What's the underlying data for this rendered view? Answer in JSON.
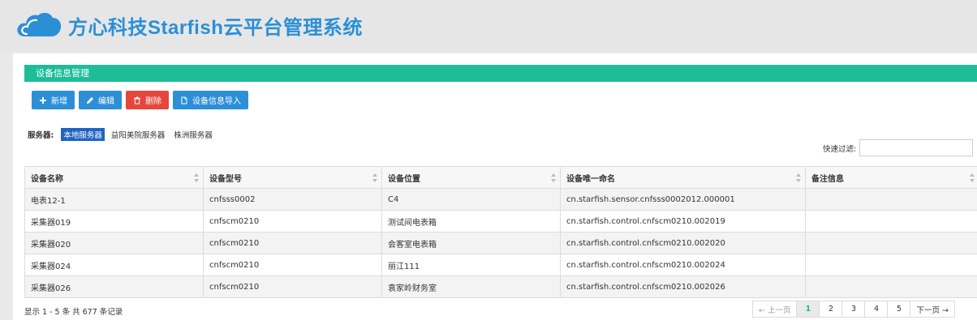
{
  "header": {
    "logo_text": "方心科技Starfish云平台管理系统",
    "logo_icon": "cloud-icon",
    "brand_color": "#2b8fd6"
  },
  "panel": {
    "title": "设备信息管理",
    "title_color": "#1ebd9a"
  },
  "toolbar": {
    "add_label": "新增",
    "edit_label": "编辑",
    "delete_label": "删除",
    "import_label": "设备信息导入"
  },
  "servers": {
    "label": "服务器:",
    "items": [
      "本地服务器",
      "益阳美院服务器",
      "株洲服务器"
    ],
    "selected": "本地服务器"
  },
  "filter": {
    "label": "快速过滤:",
    "value": ""
  },
  "table": {
    "columns": [
      "设备名称",
      "设备型号",
      "设备位置",
      "设备唯一命名",
      "备注信息"
    ],
    "rows": [
      [
        "电表12-1",
        "cnfsss0002",
        "C4",
        "cn.starfish.sensor.cnfsss0002012.000001",
        ""
      ],
      [
        "采集器019",
        "cnfscm0210",
        "测试间电表箱",
        "cn.starfish.control.cnfscm0210.002019",
        ""
      ],
      [
        "采集器020",
        "cnfscm0210",
        "会客室电表箱",
        "cn.starfish.control.cnfscm0210.002020",
        ""
      ],
      [
        "采集器024",
        "cnfscm0210",
        "丽江111",
        "cn.starfish.control.cnfscm0210.002024",
        ""
      ],
      [
        "采集器026",
        "cnfscm0210",
        "袁家岭财务室",
        "cn.starfish.control.cnfscm0210.002026",
        ""
      ]
    ]
  },
  "footer": {
    "info": "显示 1 - 5 条 共 677 条记录"
  },
  "pagination": {
    "prev": "← 上一页",
    "pages": [
      "1",
      "2",
      "3",
      "4",
      "5"
    ],
    "current": "1",
    "next": "下一页 →"
  }
}
